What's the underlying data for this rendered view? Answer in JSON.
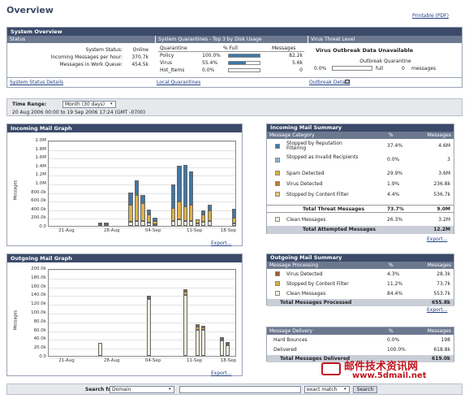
{
  "page": {
    "title": "Overview",
    "printable": "Printable (PDF)"
  },
  "system_overview": {
    "header": "System Overview",
    "status_col": "Status",
    "rows": [
      {
        "label": "System Status:",
        "value": "Online"
      },
      {
        "label": "Incoming Messages per hour:",
        "value": "370.7k"
      },
      {
        "label": "Messages in Work Queue:",
        "value": "454.5k"
      }
    ],
    "status_link": "System Status Details",
    "quarantine_col": "System Quarantines - Top 3 by Disk Usage",
    "q_headers": [
      "Quarantine",
      "% Full",
      "Messages"
    ],
    "q_rows": [
      {
        "name": "Policy",
        "full": "100.0%",
        "messages": "82.2k",
        "fill": 1.0
      },
      {
        "name": "Virus",
        "full": "55.4%",
        "messages": "5.6k",
        "fill": 0.554
      },
      {
        "name": "Hot_Items",
        "full": "0.0%",
        "messages": "0",
        "fill": 0.0
      }
    ],
    "q_link": "Local Quarantines",
    "threat_col": "Virus Threat Level",
    "threat_msg": "Virus Outbreak Data Unavailable",
    "outbreak_label": "Outbreak Quarantine",
    "outbreak_full": "0.0%",
    "outbreak_full_label": "full",
    "outbreak_count": "0",
    "outbreak_count_label": "messages",
    "threat_link": "Outbreak Details"
  },
  "time_range": {
    "label": "Time Range:",
    "value": "Month (30 days)",
    "range_text": "20 Aug 2006 00:00 to 19 Sep 2006 17:24 (GMT -0700)"
  },
  "incoming_graph": {
    "title": "Incoming Mail Graph",
    "export": "Export..."
  },
  "outgoing_graph": {
    "title": "Outgoing Mail Graph",
    "export": "Export..."
  },
  "chart_data": [
    {
      "type": "bar",
      "title": "Incoming Mail Graph",
      "ylabel": "Messages",
      "ylim": [
        0,
        2000000
      ],
      "y_ticks": [
        "2.0M",
        "1.8M",
        "1.6M",
        "1.4M",
        "1.2M",
        "1.0M",
        "800.0k",
        "600.0k",
        "400.0k",
        "200.0k",
        "0.0"
      ],
      "x_ticks": [
        "21-Aug",
        "28-Aug",
        "04-Sep",
        "11-Sep",
        "18-Sep"
      ],
      "stacked": true,
      "colors": [
        "#f3f0dc",
        "#dcb148",
        "#3d78a8"
      ],
      "bars": [
        [
          0,
          0,
          0
        ],
        [
          0,
          0,
          0
        ],
        [
          0,
          0,
          0
        ],
        [
          0,
          0,
          0
        ],
        [
          0,
          0,
          0
        ],
        [
          0,
          0,
          0
        ],
        [
          0,
          0,
          0
        ],
        [
          0,
          0,
          0
        ],
        [
          30000,
          40000,
          0
        ],
        [
          40000,
          40000,
          0
        ],
        [
          0,
          0,
          0
        ],
        [
          0,
          0,
          0
        ],
        [
          0,
          0,
          0
        ],
        [
          100000,
          400000,
          270000
        ],
        [
          120000,
          600000,
          330000
        ],
        [
          110000,
          420000,
          180000
        ],
        [
          80000,
          180000,
          120000
        ],
        [
          40000,
          70000,
          80000
        ],
        [
          0,
          0,
          0
        ],
        [
          0,
          0,
          0
        ],
        [
          120000,
          300000,
          540000
        ],
        [
          150000,
          420000,
          820000
        ],
        [
          120000,
          330000,
          970000
        ],
        [
          110000,
          380000,
          780000
        ],
        [
          60000,
          90000,
          0
        ],
        [
          100000,
          160000,
          90000
        ],
        [
          110000,
          240000,
          140000
        ],
        [
          0,
          0,
          0
        ],
        [
          0,
          0,
          0
        ],
        [
          0,
          0,
          0
        ],
        [
          60000,
          130000,
          200000
        ]
      ]
    },
    {
      "type": "bar",
      "title": "Outgoing Mail Graph",
      "ylabel": "Messages",
      "ylim": [
        0,
        200000
      ],
      "y_ticks": [
        "200.0k",
        "180.0k",
        "160.0k",
        "140.0k",
        "120.0k",
        "100.0k",
        "80.0k",
        "60.0k",
        "40.0k",
        "20.0k",
        "0.0"
      ],
      "x_ticks": [
        "21-Aug",
        "28-Aug",
        "04-Sep",
        "11-Sep",
        "18-Sep"
      ],
      "stacked": true,
      "colors": [
        "#f3f0dc",
        "#dcb148",
        "#a05a3a"
      ],
      "bars": [
        [
          0,
          0,
          0
        ],
        [
          0,
          0,
          0
        ],
        [
          0,
          0,
          0
        ],
        [
          0,
          0,
          0
        ],
        [
          0,
          0,
          0
        ],
        [
          0,
          0,
          0
        ],
        [
          0,
          0,
          0
        ],
        [
          0,
          0,
          0
        ],
        [
          30000,
          0,
          0
        ],
        [
          0,
          0,
          0
        ],
        [
          0,
          0,
          0
        ],
        [
          0,
          0,
          0
        ],
        [
          0,
          0,
          0
        ],
        [
          0,
          0,
          0
        ],
        [
          0,
          0,
          0
        ],
        [
          0,
          0,
          0
        ],
        [
          130000,
          4000,
          3000
        ],
        [
          0,
          0,
          0
        ],
        [
          0,
          0,
          0
        ],
        [
          0,
          0,
          0
        ],
        [
          0,
          0,
          0
        ],
        [
          0,
          0,
          0
        ],
        [
          138000,
          8000,
          6000
        ],
        [
          0,
          0,
          0
        ],
        [
          60000,
          7000,
          5000
        ],
        [
          60000,
          5000,
          3000
        ],
        [
          0,
          0,
          0
        ],
        [
          0,
          0,
          0
        ],
        [
          35000,
          3000,
          2000
        ],
        [
          25000,
          2000,
          1000
        ],
        [
          0,
          0,
          0
        ]
      ]
    }
  ],
  "incoming_summary": {
    "title": "Incoming Mail Summary",
    "headers": [
      "Message Category",
      "%",
      "Messages"
    ],
    "rows": [
      {
        "label": "Stopped by Reputation Filtering",
        "pct": "37.4%",
        "count": "4.6M",
        "color": "#3d78a8"
      },
      {
        "label": "Stopped as Invalid Recipients",
        "pct": "0.0%",
        "count": "3",
        "color": "#8cb4d8"
      },
      {
        "label": "Spam Detected",
        "pct": "29.9%",
        "count": "3.6M",
        "color": "#dcb148"
      },
      {
        "label": "Virus Detected",
        "pct": "1.9%",
        "count": "236.8k",
        "color": "#c07a2a"
      },
      {
        "label": "Stopped by Content Filter",
        "pct": "4.4%",
        "count": "536.7k",
        "color": "#e8c77a"
      }
    ],
    "total_threat": {
      "label": "Total Threat Messages",
      "pct": "73.7%",
      "count": "9.0M"
    },
    "clean": {
      "label": "Clean Messages",
      "pct": "26.3%",
      "count": "3.2M",
      "color": "#f3f0dc"
    },
    "total_attempted": {
      "label": "Total Attempted Messages",
      "count": "12.2M"
    },
    "export": "Export..."
  },
  "outgoing_summary": {
    "title": "Outgoing Mail Summary",
    "headers": [
      "Message Processing",
      "%",
      "Messages"
    ],
    "rows": [
      {
        "label": "Virus Detected",
        "pct": "4.3%",
        "count": "28.3k",
        "color": "#a05a3a"
      },
      {
        "label": "Stopped by Content Filter",
        "pct": "11.2%",
        "count": "73.7k",
        "color": "#dcb148"
      },
      {
        "label": "Clean Messages",
        "pct": "84.4%",
        "count": "553.7k",
        "color": "#f3f0dc"
      }
    ],
    "total": {
      "label": "Total Messages Processed",
      "count": "655.8k"
    },
    "export": "Export..."
  },
  "delivery": {
    "headers": [
      "Message Delivery",
      "%",
      "Messages"
    ],
    "rows": [
      {
        "label": "Hard Bounces",
        "pct": "0.0%",
        "count": "198"
      },
      {
        "label": "Delivered",
        "pct": "100.0%",
        "count": "618.8k"
      }
    ],
    "total": {
      "label": "Total Messages Delivered",
      "count": "619.0k"
    }
  },
  "search": {
    "label": "Search for:",
    "field": "Domain",
    "mode": "exact match",
    "button": "Search"
  },
  "watermark": {
    "cn": "邮件技术资讯网",
    "url": "www.5dmail.net"
  }
}
